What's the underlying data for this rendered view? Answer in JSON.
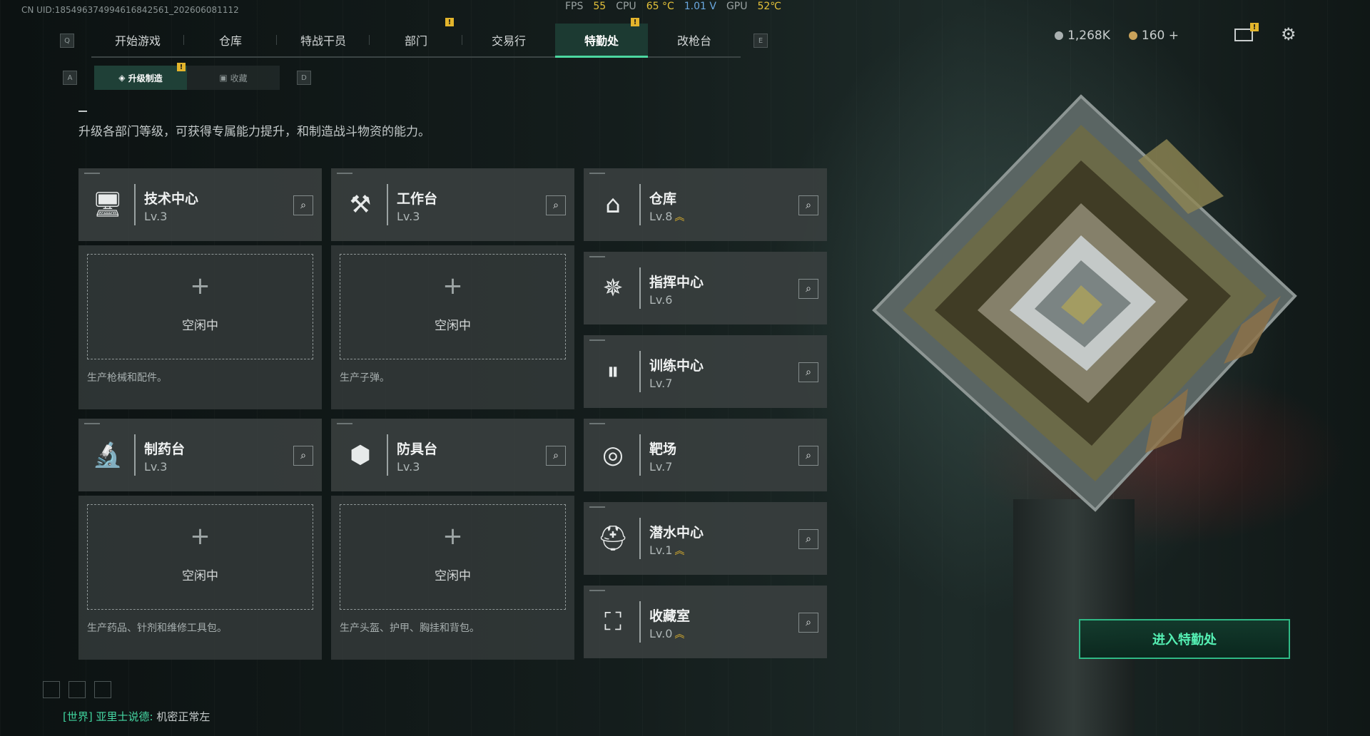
{
  "uid": "CN UID:18549637499461684256​1_202606081112",
  "perf": {
    "fps_label": "FPS",
    "fps": "55",
    "cpu_label": "CPU",
    "cpu_temp": "65 °C",
    "cpu_v": "1.01 V",
    "gpu_label": "GPU",
    "gpu_temp": "52℃"
  },
  "hotkeys": {
    "left": "Q",
    "right": "E",
    "sub_left": "A",
    "sub_right": "D"
  },
  "tabs": [
    {
      "label": "开始游戏"
    },
    {
      "label": "仓库"
    },
    {
      "label": "特战干员"
    },
    {
      "label": "部门"
    },
    {
      "label": "交易行"
    },
    {
      "label": "特勤处"
    },
    {
      "label": "改枪台"
    }
  ],
  "warn_mark": "!",
  "currency": {
    "silver": "1,268K",
    "gold": "160",
    "add": "+"
  },
  "subtabs": [
    {
      "label": "升级制造"
    },
    {
      "label": "收藏"
    }
  ],
  "description": "升级各部门等级，可获得专属能力提升，和制造战斗物资的能力。",
  "slots": {
    "tech": {
      "name": "技术中心",
      "level": "Lv.3",
      "idle": "空闲中",
      "plus": "+",
      "hint": "生产枪械和配件。"
    },
    "workbench": {
      "name": "工作台",
      "level": "Lv.3",
      "idle": "空闲中",
      "plus": "+",
      "hint": "生产子弹。"
    },
    "pharmacy": {
      "name": "制药台",
      "level": "Lv.3",
      "idle": "空闲中",
      "plus": "+",
      "hint": "生产药品、针剂和维修工具包。"
    },
    "armor": {
      "name": "防具台",
      "level": "Lv.3",
      "idle": "空闲中",
      "plus": "+",
      "hint": "生产头盔、护甲、胸挂和背包。"
    }
  },
  "facilities": [
    {
      "name": "仓库",
      "level": "Lv.8",
      "upgrade": "︽"
    },
    {
      "name": "指挥中心",
      "level": "Lv.6",
      "upgrade": ""
    },
    {
      "name": "训练中心",
      "level": "Lv.7",
      "upgrade": ""
    },
    {
      "name": "靶场",
      "level": "Lv.7",
      "upgrade": ""
    },
    {
      "name": "潜水中心",
      "level": "Lv.1",
      "upgrade": "︽"
    },
    {
      "name": "收藏室",
      "level": "Lv.0",
      "upgrade": "︽"
    }
  ],
  "enter_button": "进入特勤处",
  "chat": {
    "channel": "[世界]",
    "speaker": "亚里士说德:",
    "message": "机密正常左"
  },
  "icons": {
    "search": "⌕",
    "gear": "⚙",
    "mail": "mail-icon"
  },
  "colors": {
    "accent": "#4cd7a0",
    "warning": "#e3b52c"
  }
}
